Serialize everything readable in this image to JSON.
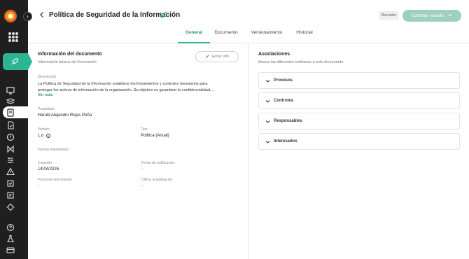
{
  "header": {
    "title": "Política de Seguridad de la Información",
    "status_badge": "Borrador",
    "change_status_label": "Cambiar estado"
  },
  "tabs": [
    {
      "label": "General",
      "active": true
    },
    {
      "label": "Documento",
      "active": false
    },
    {
      "label": "Versionamiento",
      "active": false
    },
    {
      "label": "Historial",
      "active": false
    }
  ],
  "doc_info": {
    "title": "Información del documento",
    "subtitle": "Información básica del documento",
    "edit_label": "Editar info",
    "description_label": "Descripción",
    "description_line1": "La Política de Seguridad de la Información establece los lineamientos y controles necesarios para",
    "description_line2": "proteger los activos de información de la organización. Su objetivo es garantizar la confidencialidad,...",
    "see_more": "Ver más",
    "owner_label": "Propietario",
    "owner": "Harold Alejandro Rojas Peña",
    "version_label": "Versión",
    "version": "1.0",
    "type_label": "Tipo",
    "type": "Política (Anual)",
    "dates_heading": "Fechas importantes",
    "created_label": "Creación",
    "created": "14/04/2026",
    "published_label": "Fecha de publicacion",
    "published": "-",
    "expiry_label": "Fecha de vencimiento",
    "expiry": "-",
    "updated_label": "Última actualización",
    "updated": "-"
  },
  "associations": {
    "title": "Asociaciones",
    "subtitle": "Asocia las diferentes entidades a este documento",
    "items": [
      {
        "label": "Procesos"
      },
      {
        "label": "Controles"
      },
      {
        "label": "Responsables"
      },
      {
        "label": "Interesados"
      }
    ]
  },
  "colors": {
    "accent": "#2bb594",
    "accent_text": "#2a8f74",
    "sidebar_bg": "#1f1f1f",
    "button_disabled": "#9ed0bf"
  },
  "icons": {
    "back": "chevron-left-icon",
    "edit_title": "pencil-icon",
    "change_status": "chevron-down-icon",
    "edit_info": "pencil-icon",
    "version_info": "info-icon",
    "accordion": "chevron-down-icon"
  }
}
